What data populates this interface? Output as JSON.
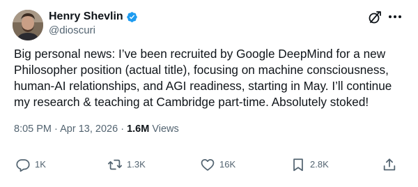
{
  "author": {
    "display_name": "Henry Shevlin",
    "handle": "@dioscuri",
    "verified": true
  },
  "tweet": {
    "text_lines": [
      "Big personal news: I’ve been recruited by Google DeepMind for a new",
      "Philosopher position (actual title), focusing on machine consciousness,",
      "human-AI relationships, and AGI readiness, starting in May. I’ll continue",
      "my research & teaching at Cambridge part-time. Absolutely stoked!"
    ],
    "time": "8:05 PM",
    "date": "Apr 13, 2026",
    "separator": "·",
    "views_count": "1.6M",
    "views_label": "Views"
  },
  "actions": {
    "replies": "1K",
    "reposts": "1.3K",
    "likes": "16K",
    "bookmarks": "2.8K"
  },
  "colors": {
    "text": "#0f1419",
    "secondary": "#536471",
    "verified_blue": "#1d9bf0"
  },
  "icons": {
    "top_action": "grok-icon",
    "more": "more-icon",
    "reply": "reply-icon",
    "repost": "repost-icon",
    "like": "heart-icon",
    "bookmark": "bookmark-icon",
    "share": "share-icon"
  }
}
